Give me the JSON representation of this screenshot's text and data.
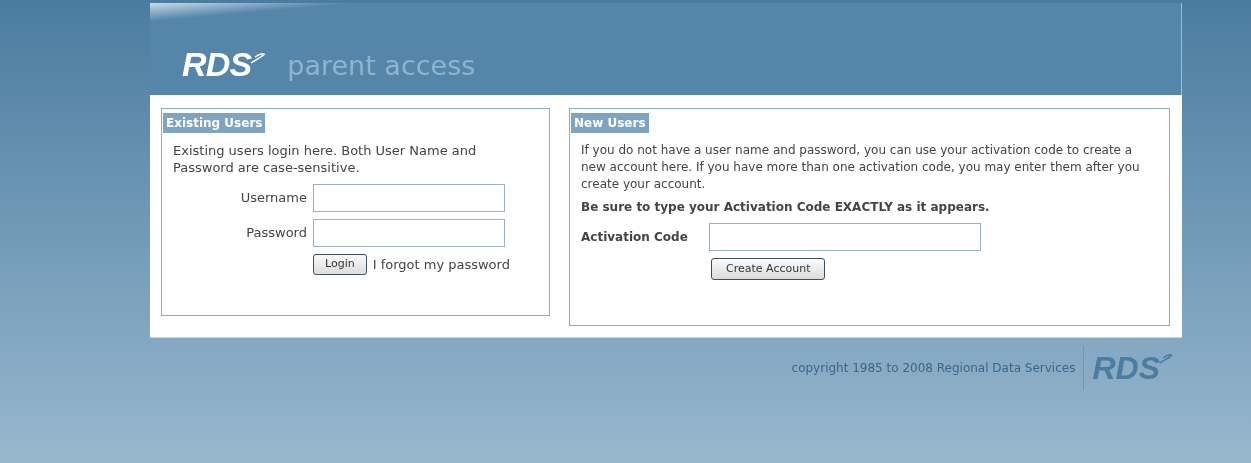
{
  "header": {
    "logo": "RDS",
    "title": "parent access"
  },
  "existing_users": {
    "heading": "Existing Users",
    "intro": "Existing users login here. Both User Name and Password are case-sensitive.",
    "fields": [
      {
        "label": "Username"
      },
      {
        "label": "Password"
      }
    ],
    "login_button": "Login",
    "forgot_link": "I forgot my password"
  },
  "new_users": {
    "heading": "New Users",
    "intro": "If you do not have a user name and password, you can use your activation code to create a new account here. If you have more than one activation code, you may enter them after you create your account.",
    "warning": "Be sure to type your Activation Code EXACTLY as it appears.",
    "field_label": "Activation Code",
    "create_button": "Create Account"
  },
  "footer": {
    "copyright": "copyright 1985 to 2008 Regional Data Services",
    "logo": "RDS"
  }
}
